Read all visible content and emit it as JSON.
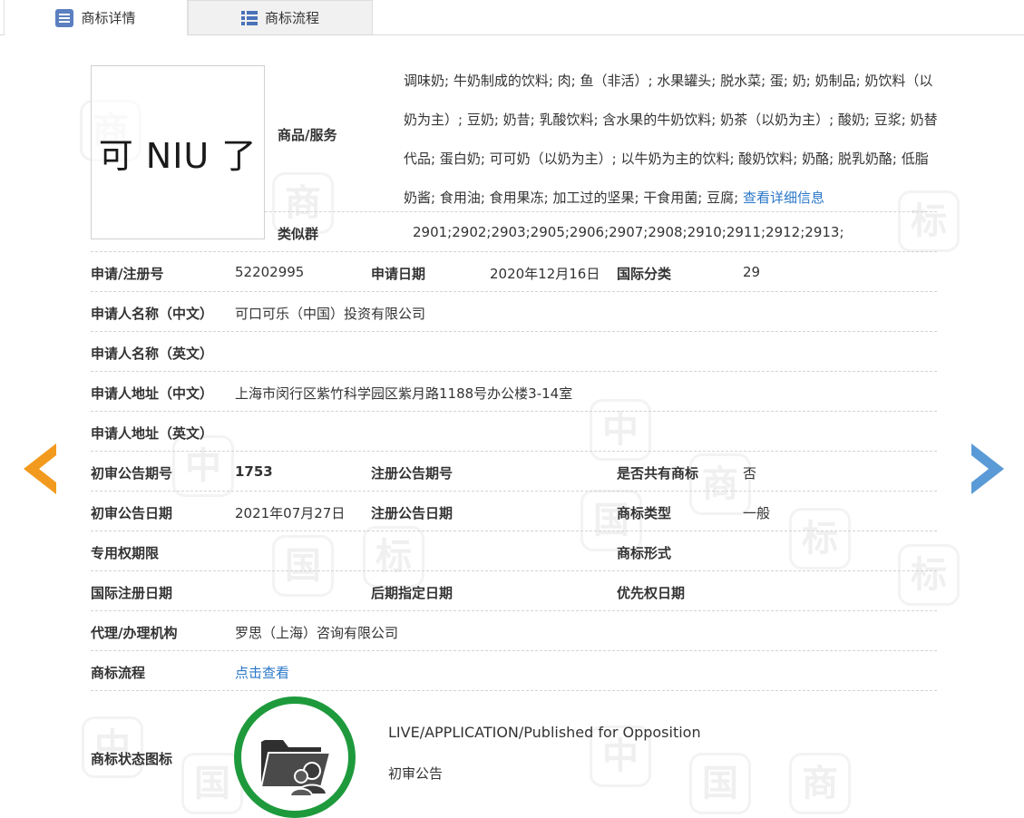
{
  "tabs": [
    {
      "label": "商标详情",
      "icon": "document-list-icon"
    },
    {
      "label": "商标流程",
      "icon": "grid-list-icon"
    }
  ],
  "trademark": {
    "logo_text": "可 NIU 了",
    "goods_label": "商品/服务",
    "goods_text": "调味奶; 牛奶制成的饮料; 肉; 鱼（非活）; 水果罐头; 脱水菜; 蛋; 奶; 奶制品; 奶饮料（以奶为主）; 豆奶; 奶昔; 乳酸饮料; 含水果的牛奶饮料; 奶茶（以奶为主）; 酸奶; 豆浆; 奶替代品; 蛋白奶; 可可奶（以奶为主）; 以牛奶为主的饮料; 酸奶饮料; 奶酪; 脱乳奶酪; 低脂奶酱; 食用油; 食用果冻; 加工过的坚果; 干食用菌; 豆腐;",
    "goods_more_link": "查看详细信息",
    "similar_group_label": "类似群",
    "similar_group_value": "2901;2902;2903;2905;2906;2907;2908;2910;2911;2912;2913;"
  },
  "fields": {
    "reg_no_label": "申请/注册号",
    "reg_no": "52202995",
    "apply_date_label": "申请日期",
    "apply_date": "2020年12月16日",
    "intl_class_label": "国际分类",
    "intl_class": "29",
    "applicant_cn_label": "申请人名称（中文）",
    "applicant_cn": "可口可乐（中国）投资有限公司",
    "applicant_en_label": "申请人名称（英文）",
    "applicant_en": "",
    "address_cn_label": "申请人地址（中文）",
    "address_cn": "上海市闵行区紫竹科学园区紫月路1188号办公楼3-14室",
    "address_en_label": "申请人地址（英文）",
    "address_en": "",
    "prelim_issue_label": "初审公告期号",
    "prelim_issue": "1753",
    "reg_issue_label": "注册公告期号",
    "reg_issue": "",
    "shared_label": "是否共有商标",
    "shared": "否",
    "prelim_date_label": "初审公告日期",
    "prelim_date": "2021年07月27日",
    "reg_date_label": "注册公告日期",
    "reg_date": "",
    "type_label": "商标类型",
    "type": "一般",
    "exclusive_label": "专用权期限",
    "exclusive": "",
    "form_label": "商标形式",
    "form": "",
    "intl_reg_date_label": "国际注册日期",
    "intl_reg_date": "",
    "later_date_label": "后期指定日期",
    "later_date": "",
    "priority_date_label": "优先权日期",
    "priority_date": "",
    "agent_label": "代理/办理机构",
    "agent": "罗思（上海）咨询有限公司",
    "process_label": "商标流程",
    "process_link": "点击查看",
    "status_icon_label": "商标状态图标",
    "status_en": "LIVE/APPLICATION/Published for Opposition",
    "status_cn": "初审公告"
  },
  "nav": {
    "prev_icon": "arrow-left-icon",
    "next_icon": "arrow-right-icon"
  },
  "colors": {
    "link": "#2a77c9",
    "prev_arrow": "#f29a1e",
    "next_arrow": "#5a9ad6",
    "status_ring": "#1e9a3c",
    "tab_icon": "#5b7fc0"
  },
  "watermark_text": [
    "中",
    "国",
    "商",
    "标"
  ]
}
